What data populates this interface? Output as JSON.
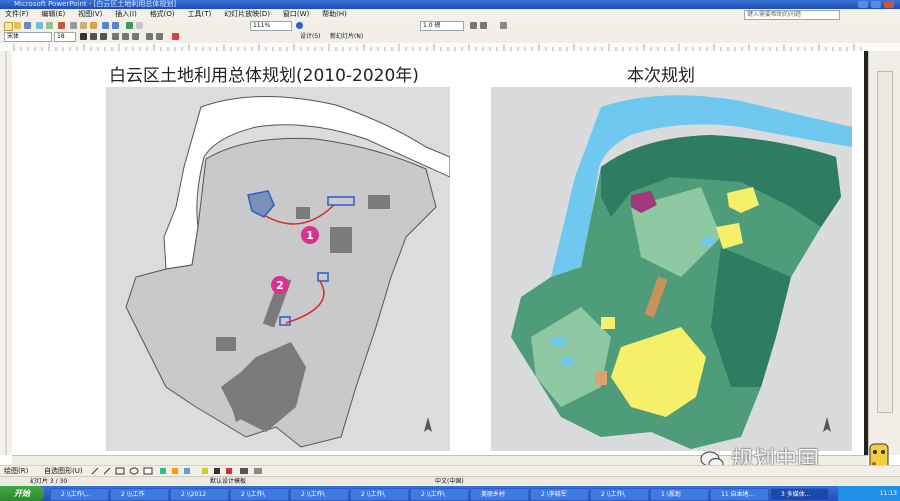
{
  "app": {
    "title_bar": "Microsoft PowerPoint - [白云区土地利用总体规划]",
    "menus": [
      "文件(F)",
      "编辑(E)",
      "视图(V)",
      "插入(I)",
      "格式(O)",
      "工具(T)",
      "幻灯片放映(D)",
      "窗口(W)",
      "帮助(H)"
    ],
    "help_placeholder": "键入需要帮助的问题",
    "font_name": "宋体",
    "font_size": "18",
    "zoom": "111%",
    "line_width": "1.0 磅",
    "design_button": "设计(S)",
    "new_slide_button": "新幻灯片(N)"
  },
  "slide": {
    "left_title": "白云区土地利用总体规划(2010-2020年)",
    "right_title": "本次规划",
    "marker_1": "1",
    "marker_2": "2",
    "colors": {
      "bg_gray": "#dcdcdf",
      "land_gray": "#c9c9cc",
      "built_dark": "#7b7b7e",
      "river": "#ffffff",
      "green_dark": "#2e7d62",
      "green_mid": "#4f9c7a",
      "green_light": "#8ec9a4",
      "yellow": "#f6ef6a",
      "water_blue": "#6ec8ef",
      "magenta": "#a3377e",
      "marker_pink": "#d6338c",
      "route_red": "#d62a2a",
      "parcel_blue": "#2b5fc7"
    }
  },
  "drawbar": {
    "draw_label": "绘图(R)",
    "autoshape_label": "自选图形(U)"
  },
  "status": {
    "slide_info": "幻灯片 3 / 30",
    "design_name": "默认设计模板",
    "language": "中文(中国)"
  },
  "watermark": {
    "text": "规划中国"
  },
  "taskbar": {
    "start_label": "开始",
    "tasks": [
      "2 \\\\工作\\...",
      "2 \\\\\\工作",
      "2 \\\\2012",
      "2 \\\\工作\\",
      "2 \\\\工作\\",
      "2 \\\\工作\\",
      "2 \\\\工作\\",
      "美丽乡村",
      "2 \\李晓军",
      "2 \\\\工作\\",
      "1 \\规划",
      "11 自本地...",
      "3 多媒体..."
    ],
    "clock": "11:13"
  }
}
